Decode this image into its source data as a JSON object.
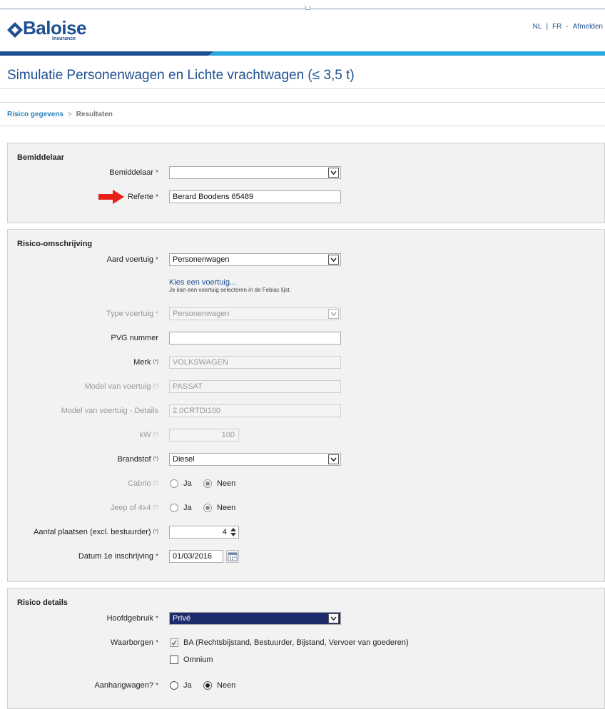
{
  "header": {
    "logo_text": "Baloise",
    "logo_sub": "Insurance",
    "lang_nl": "NL",
    "lang_sep": "|",
    "lang_fr": "FR",
    "lang_dash": "-",
    "logout": "Afmelden",
    "brand_color": "#1d4f91",
    "accent_color": "#29a8e0"
  },
  "page": {
    "title": "Simulatie Personenwagen en Lichte vrachtwagen (≤ 3,5 t)"
  },
  "breadcrumb": {
    "step1": "Risico gegevens",
    "separator": ">",
    "step2": "Resultaten"
  },
  "bemiddelaar": {
    "title": "Bemiddelaar",
    "bemiddelaar_label": "Bemiddelaar",
    "bemiddelaar_value": "",
    "referte_label": "Referte",
    "referte_value": "Berard Boodens 65489",
    "required": "*"
  },
  "risico": {
    "title": "Risico-omschrijving",
    "aard_label": "Aard voertuig",
    "aard_value": "Personenwagen",
    "kies_link": "Kies een voertuig...",
    "kies_hint": "Je kan een voertuig selecteren in de Febiac lijst.",
    "type_label": "Type voertuig",
    "type_value": "Personenwagen",
    "pvg_label": "PVG nummer",
    "pvg_value": "",
    "merk_label": "Merk",
    "merk_value": "VOLKSWAGEN",
    "model_label": "Model van voertuig",
    "model_value": "PASSAT",
    "details_label": "Model van voertuig - Details",
    "details_value": "2.0CRTDI100",
    "kw_label": "kW",
    "kw_value": "100",
    "brandstof_label": "Brandstof",
    "brandstof_value": "Diesel",
    "cabrio_label": "Cabrio",
    "jeep_label": "Jeep of 4x4",
    "ja": "Ja",
    "neen": "Neen",
    "plaatsen_label": "Aantal plaatsen (excl. bestuurder)",
    "plaatsen_value": "4",
    "datum_label": "Datum 1e inschrijving",
    "datum_value": "01/03/2016",
    "pstar": "(*)",
    "required": "*"
  },
  "details": {
    "title": "Risico details",
    "hoofd_label": "Hoofdgebruik",
    "hoofd_value": "Privé",
    "waarborgen_label": "Waarborgen",
    "ba_label": "BA (Rechtsbijstand, Bestuurder, Bijstand, Vervoer van goederen)",
    "omnium_label": "Omnium",
    "aanhang_label": "Aanhangwagen?",
    "ja": "Ja",
    "neen": "Neen",
    "required": "*"
  },
  "annotation": {
    "arrow_color": "#e8201a"
  },
  "icons": [
    "logo-diamond-icon",
    "dropdown-arrow-icon",
    "red-arrow-icon",
    "spinner-icon",
    "calendar-icon",
    "checkmark-icon"
  ]
}
